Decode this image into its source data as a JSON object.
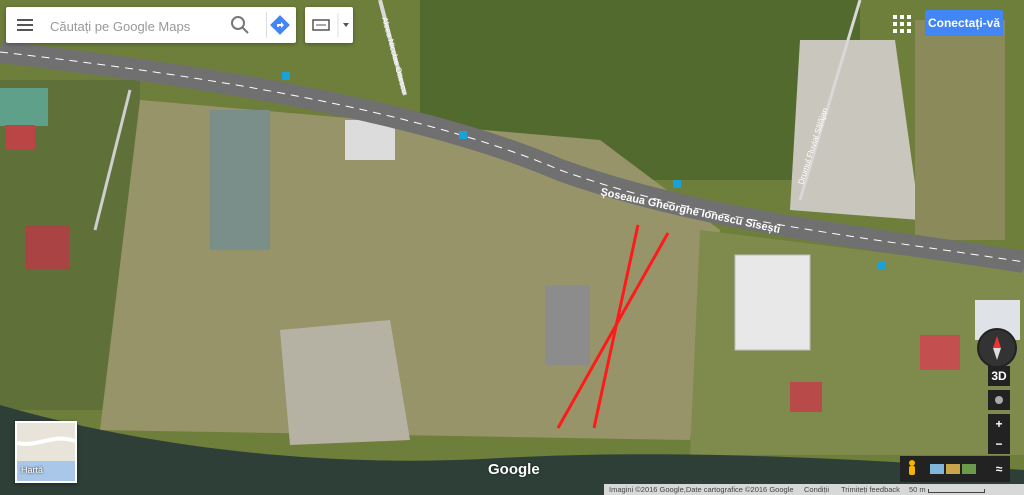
{
  "search": {
    "placeholder": "Căutați pe Google Maps"
  },
  "header": {
    "sign_in_label": "Conectați-vă"
  },
  "map": {
    "road_label": "Șoseaua Gheorghe Ionescu Sisești",
    "street_label_1": "Aleea Nicolae Ottescu",
    "street_label_2": "Drumul Fluvial Sălăjan",
    "thumb_label": "Hartă",
    "logo": "Google",
    "overlay_line_color": "#ff1a1a"
  },
  "controls": {
    "three_d_label": "3D",
    "zoom_in": "+",
    "zoom_out": "−",
    "expand": "≈"
  },
  "footer": {
    "imagery": "Imagini ©2016 Google,Date cartografice ©2016 Google",
    "terms": "Condiții",
    "feedback": "Trimiteți feedback",
    "scale": "50 m"
  }
}
